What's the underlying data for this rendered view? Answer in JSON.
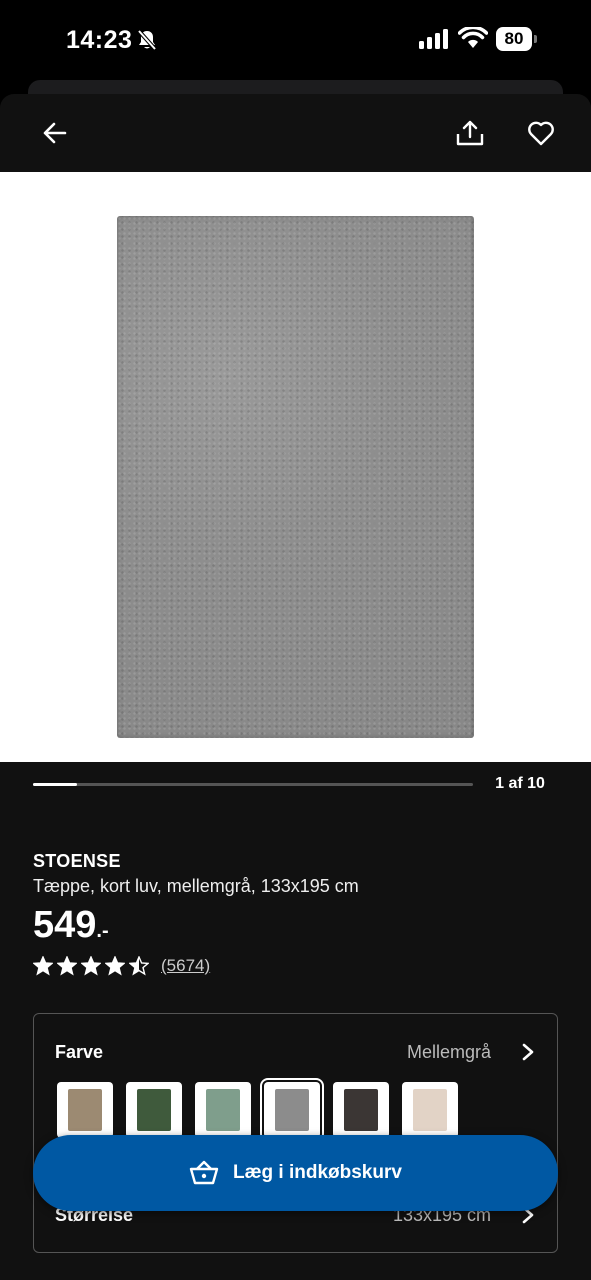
{
  "status_bar": {
    "time": "14:23",
    "battery": "80",
    "icons": [
      "bell-slash-icon",
      "signal-icon",
      "wifi-icon",
      "battery-icon"
    ]
  },
  "topbar": {
    "icons": [
      "arrow-left-icon",
      "share-icon",
      "heart-icon"
    ]
  },
  "gallery": {
    "counter": "1 af 10",
    "progress": 0.1
  },
  "product": {
    "name": "STOENSE",
    "description": "Tæppe, kort luv, mellemgrå, 133x195 cm",
    "price": "549",
    "price_suffix": ".-",
    "rating": 4.5,
    "review_count": "(5674)"
  },
  "options": {
    "color_label": "Farve",
    "color_value": "Mellemgrå",
    "swatches": [
      {
        "color": "#9c8a72",
        "selected": false
      },
      {
        "color": "#3f5a3c",
        "selected": false
      },
      {
        "color": "#7f9e8c",
        "selected": false
      },
      {
        "color": "#8c8c8c",
        "selected": true
      },
      {
        "color": "#3b3634",
        "selected": false
      },
      {
        "color": "#e2d3c6",
        "selected": false
      }
    ],
    "size_label": "Størrelse",
    "size_value": "133x195 cm"
  },
  "cart_button": {
    "label": "Læg i indkøbskurv",
    "icon": "basket-icon",
    "color": "#0058a3"
  }
}
